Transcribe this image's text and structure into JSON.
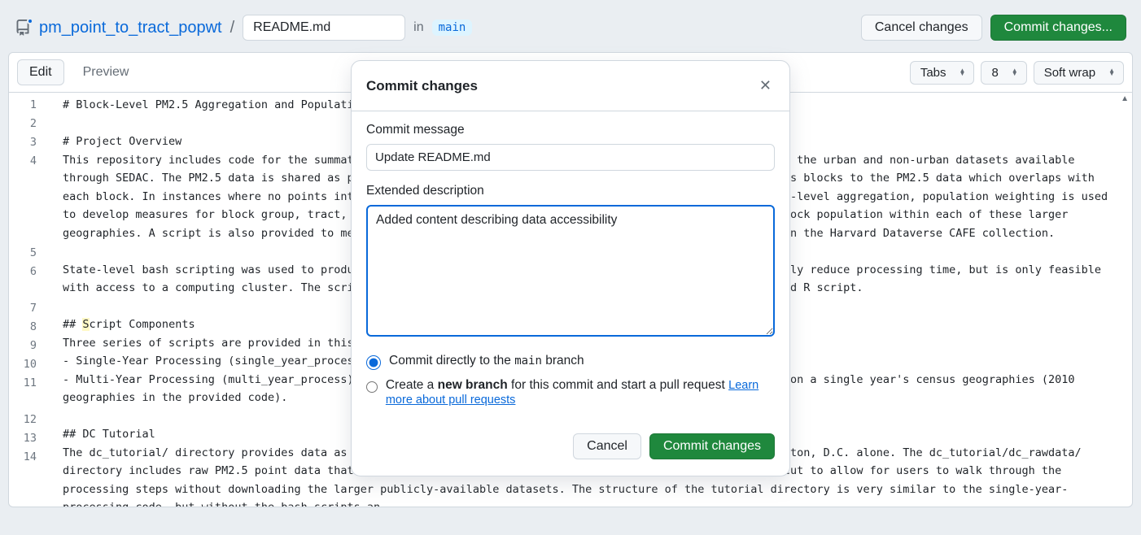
{
  "header": {
    "repo_name": "pm_point_to_tract_popwt",
    "slash": "/",
    "filename": "README.md",
    "in_label": "in",
    "branch": "main",
    "cancel_btn": "Cancel changes",
    "commit_btn": "Commit changes..."
  },
  "toolbar": {
    "edit_tab": "Edit",
    "preview_tab": "Preview",
    "indent_mode": "Tabs",
    "indent_size": "8",
    "wrap_mode": "Soft wrap"
  },
  "editor": {
    "lines": [
      "# Block-Level PM2.5 Aggregation and Population W",
      "",
      "# Project Overview",
      "This repository includes code for the summation of Di et al. PM2.5 data to the census block group level across the urban and non-urban datasets available through SEDAC. The PM2.5 data is shared as point files, and the R code provided in this repository joins census blocks to the PM2.5 data which overlaps with each block. In instances where no points intersect a census block, the nearest point will be used. After block-level aggregation, population weighting is used to develop measures for block group, tract, and county-level data. The weighting uses the proportion of the block population within each of these larger geographies. A script is also provided to merge the data across states and format them as they are available on the Harvard Dataverse CAFE collection.",
      "",
      "State-level bash scripting was used to produce the publicly-available data. This parallelization can drastically reduce processing time, but is only feasible with access to a computing cluster. The scripts can also be run individually for a given state via the provided R script.",
      "",
      "## Script Components",
      "Three series of scripts are provided in this rep",
      "- Single-Year Processing (single_year_process):",
      "- Multi-Year Processing (multi_year_process): Follows the single-year processing, but the PM2.5 data is based on a single year's census geographies (2010 geographies in the provided code).",
      "",
      "## DC Tutorial",
      "The dc_tutorial/ directory provides data as well as a tutorial script to process block-level PM2.5 for Washington, D.C. alone. The dc_tutorial/dc_rawdata/ directory includes raw PM2.5 point data that has already been subset to the extent of DC. The PM2.5 data was cut to allow for users to walk through the processing steps without downloading the larger publicly-available datasets. The structure of the tutorial directory is very similar to the single-year-processing code, but without the bash scripts an",
      ""
    ],
    "highlight_line_index": 7,
    "highlight_char_start": 3,
    "highlight_char_end": 4
  },
  "modal": {
    "title": "Commit changes",
    "commit_msg_label": "Commit message",
    "commit_msg_value": "Update README.md",
    "ext_desc_label": "Extended description",
    "ext_desc_value": "Added content describing data accessibility",
    "radio_direct_pre": "Commit directly to the ",
    "radio_direct_branch": "main",
    "radio_direct_post": " branch",
    "radio_new_pre": "Create a ",
    "radio_new_bold": "new branch",
    "radio_new_post": " for this commit and start a pull request ",
    "learn_link": "Learn more about pull requests",
    "cancel": "Cancel",
    "commit": "Commit changes"
  }
}
